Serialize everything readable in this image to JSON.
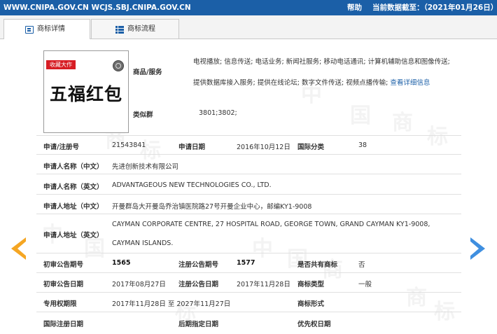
{
  "topbar": {
    "site": "WWW.CNIPA.GOV.CN WCJS.SBJ.CNIPA.GOV.CN",
    "help": "帮助",
    "as_of": "当前数据截至：（2021年01月26日）"
  },
  "tabs": [
    {
      "label": "商标详情",
      "active": true,
      "icon": "document-list-icon"
    },
    {
      "label": "商标流程",
      "active": false,
      "icon": "list-icon"
    }
  ],
  "trademark": {
    "badge": "收藏大作",
    "mark_text": "五福红包"
  },
  "goods": {
    "label": "商品/服务",
    "text": "电视播放; 信息传送; 电话业务; 新闻社服务; 移动电话通讯; 计算机辅助信息和图像传送; 提供数据库接入服务; 提供在线论坛; 数字文件传送; 视频点播传输;",
    "link": "查看详细信息"
  },
  "similar_group": {
    "label": "类似群",
    "value": "3801;3802;"
  },
  "fields": {
    "reg_no": {
      "label": "申请/注册号",
      "value": "21543841"
    },
    "app_date": {
      "label": "申请日期",
      "value": "2016年10月12日"
    },
    "intl_class": {
      "label": "国际分类",
      "value": "38"
    },
    "applicant_cn": {
      "label": "申请人名称（中文）",
      "value": "先进创新技术有限公司"
    },
    "applicant_en": {
      "label": "申请人名称（英文）",
      "value": "ADVANTAGEOUS NEW TECHNOLOGIES CO., LTD."
    },
    "address_cn": {
      "label": "申请人地址（中文）",
      "value": "开曼群岛大开曼岛乔治镇医院路27号开曼企业中心，邮编KY1-9008"
    },
    "address_en": {
      "label": "申请人地址（英文）",
      "value_line1": "CAYMAN CORPORATE CENTRE, 27 HOSPITAL ROAD, GEORGE TOWN, GRAND CAYMAN KY1-9008,",
      "value_line2": "CAYMAN ISLANDS."
    },
    "prelim_no": {
      "label": "初审公告期号",
      "value": "1565"
    },
    "reg_notice_no": {
      "label": "注册公告期号",
      "value": "1577"
    },
    "shared": {
      "label": "是否共有商标",
      "value": "否"
    },
    "prelim_date": {
      "label": "初审公告日期",
      "value": "2017年08月27日"
    },
    "reg_notice_date": {
      "label": "注册公告日期",
      "value": "2017年11月28日"
    },
    "tm_type": {
      "label": "商标类型",
      "value": "一般"
    },
    "exclusive_period": {
      "label": "专用权期限",
      "value": "2017年11月28日 至 2027年11月27日"
    },
    "tm_form": {
      "label": "商标形式",
      "value": ""
    },
    "intl_reg_date": {
      "label": "国际注册日期",
      "value": ""
    },
    "later_designation_date": {
      "label": "后期指定日期",
      "value": ""
    },
    "priority_date": {
      "label": "优先权日期",
      "value": ""
    }
  },
  "colors": {
    "topbar": "#1b5fa7",
    "badge": "#d71d24",
    "arrow_left": "#f5a623",
    "arrow_right": "#3f8fe0",
    "link": "#1b5fa7"
  }
}
